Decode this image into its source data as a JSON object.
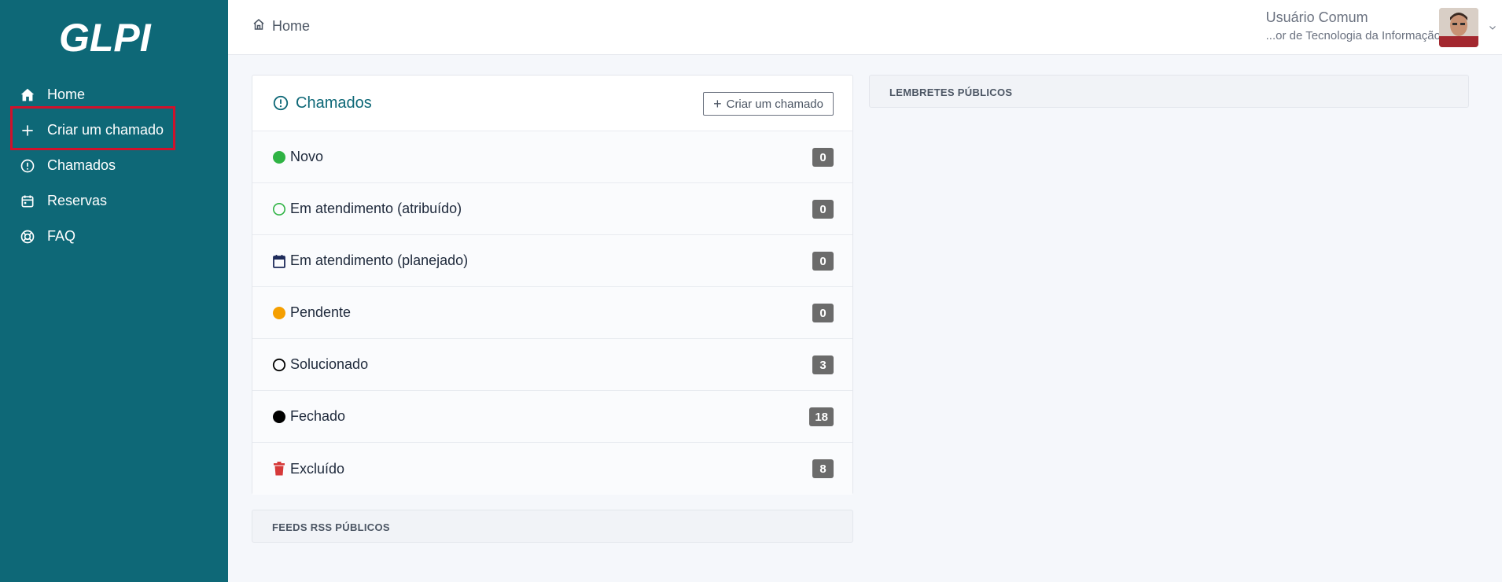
{
  "brand": {
    "logo_text": "GLPI",
    "sidebar_color": "#0e6877",
    "accent_color": "#0e6877",
    "highlight_color": "#d0112b"
  },
  "sidebar": {
    "items": [
      {
        "label": "Home",
        "icon": "home-icon"
      },
      {
        "label": "Criar um chamado",
        "icon": "plus-icon"
      },
      {
        "label": "Chamados",
        "icon": "alert-circle-icon"
      },
      {
        "label": "Reservas",
        "icon": "calendar-icon"
      },
      {
        "label": "FAQ",
        "icon": "lifebuoy-icon"
      }
    ]
  },
  "header": {
    "breadcrumb": "Home",
    "user_name": "Usuário Comum",
    "user_role": "...or de Tecnologia da Informação"
  },
  "tickets": {
    "title": "Chamados",
    "new_button": "Criar um chamado",
    "statuses": [
      {
        "label": "Novo",
        "count": "0",
        "icon": "filled-green-circle-icon",
        "color": "#2fb344"
      },
      {
        "label": "Em atendimento (atribuído)",
        "count": "0",
        "icon": "outline-green-circle-icon",
        "color": "#2fb344"
      },
      {
        "label": "Em atendimento (planejado)",
        "count": "0",
        "icon": "calendar-icon",
        "color": "#1d2a5a"
      },
      {
        "label": "Pendente",
        "count": "0",
        "icon": "filled-orange-circle-icon",
        "color": "#f59f00"
      },
      {
        "label": "Solucionado",
        "count": "3",
        "icon": "outline-black-circle-icon",
        "color": "#000000"
      },
      {
        "label": "Fechado",
        "count": "18",
        "icon": "filled-black-circle-icon",
        "color": "#000000"
      },
      {
        "label": "Excluído",
        "count": "8",
        "icon": "trash-icon",
        "color": "#d63939"
      }
    ]
  },
  "rss": {
    "title": "FEEDS RSS PÚBLICOS"
  },
  "reminders": {
    "title": "LEMBRETES PÚBLICOS"
  }
}
